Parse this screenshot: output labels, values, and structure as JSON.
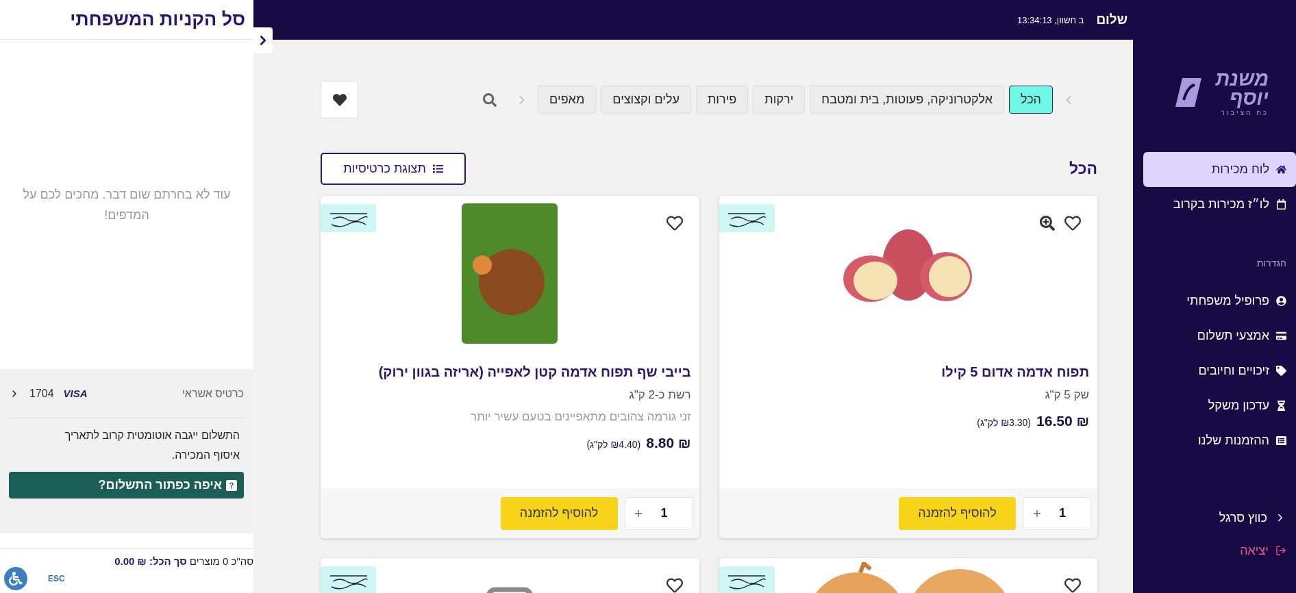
{
  "top_bar": {
    "greeting": "שלום",
    "datetime": "ב חשוון, 13:34:13"
  },
  "sidebar": {
    "logo": {
      "name": "משנת יוסף",
      "tagline": "כח הציבור"
    },
    "items": [
      {
        "kind": "link",
        "label": "לוח מכירות",
        "selected": true
      },
      {
        "kind": "link",
        "label": "לו״ז מכירות בקרוב",
        "selected": false
      },
      {
        "kind": "section",
        "label": "הגדרות"
      },
      {
        "kind": "link",
        "label": "פרופיל משפחתי",
        "selected": false
      },
      {
        "kind": "link",
        "label": "אמצעי תשלום",
        "selected": false
      },
      {
        "kind": "link",
        "label": "זיכויים וחיובים",
        "selected": false
      },
      {
        "kind": "link",
        "label": "עדכון משקל",
        "selected": false
      },
      {
        "kind": "link",
        "label": "ההזמנות שלנו",
        "selected": false
      }
    ],
    "footer": [
      {
        "kind": "collapse",
        "label": "כווץ סרגל"
      },
      {
        "kind": "logout",
        "label": "יציאה"
      }
    ]
  },
  "categories": [
    {
      "label": "הכל",
      "selected": true
    },
    {
      "label": "אלקטרוניקה, פעוטות, בית ומטבח",
      "selected": false
    },
    {
      "label": "ירקות",
      "selected": false
    },
    {
      "label": "פירות",
      "selected": false
    },
    {
      "label": "עלים וקצוצים",
      "selected": false
    },
    {
      "label": "מאפים",
      "selected": false
    }
  ],
  "heading": "הכל",
  "view_toggle": {
    "label": "תצוגת כרטיסיות"
  },
  "products": [
    {
      "title": "תפוח אדמה אדום 5 קילו",
      "package": "שק 5 ק\"ג",
      "price": "₪ 16.50",
      "unit_price": "(₪3.30 לק\"ג)",
      "quantity": "1",
      "add_label": "להוסיף להזמנה",
      "favorite": false,
      "zoom": true
    },
    {
      "title": "בייבי שף תפוח אדמה קטן לאפייה (אריזה בגוון ירוק)",
      "package": "רשת כ-2 ק\"ג",
      "description": "זני גורמה צהובים מתאפיינים בטעם עשיר יותר",
      "price": "₪ 8.80",
      "unit_price": "(₪4.40 לק\"ג)",
      "quantity": "1",
      "add_label": "להוסיף להזמנה",
      "favorite": false,
      "zoom": false
    }
  ],
  "more_products": [
    {
      "favorite": false
    },
    {
      "favorite": false
    }
  ],
  "cart": {
    "title": "סל הקניות המשפחתי",
    "empty_message": "עוד לא בחרתם שום דבר. מחכים לכם על המדפים!",
    "payment": {
      "label": "כרטיס אשראי",
      "brand": "VISA",
      "last_digits": "1704"
    },
    "payment_note": "התשלום ייגבה אוטומטית קרוב לתאריך איסוף המכירה.",
    "help_button": "איפה כפתור התשלום?",
    "summary": {
      "count": "סה\"כ 0 מוצרים",
      "total": "סך הכל: ₪ 0.00"
    }
  },
  "accessibility": {
    "shortcut": "ESC"
  }
}
